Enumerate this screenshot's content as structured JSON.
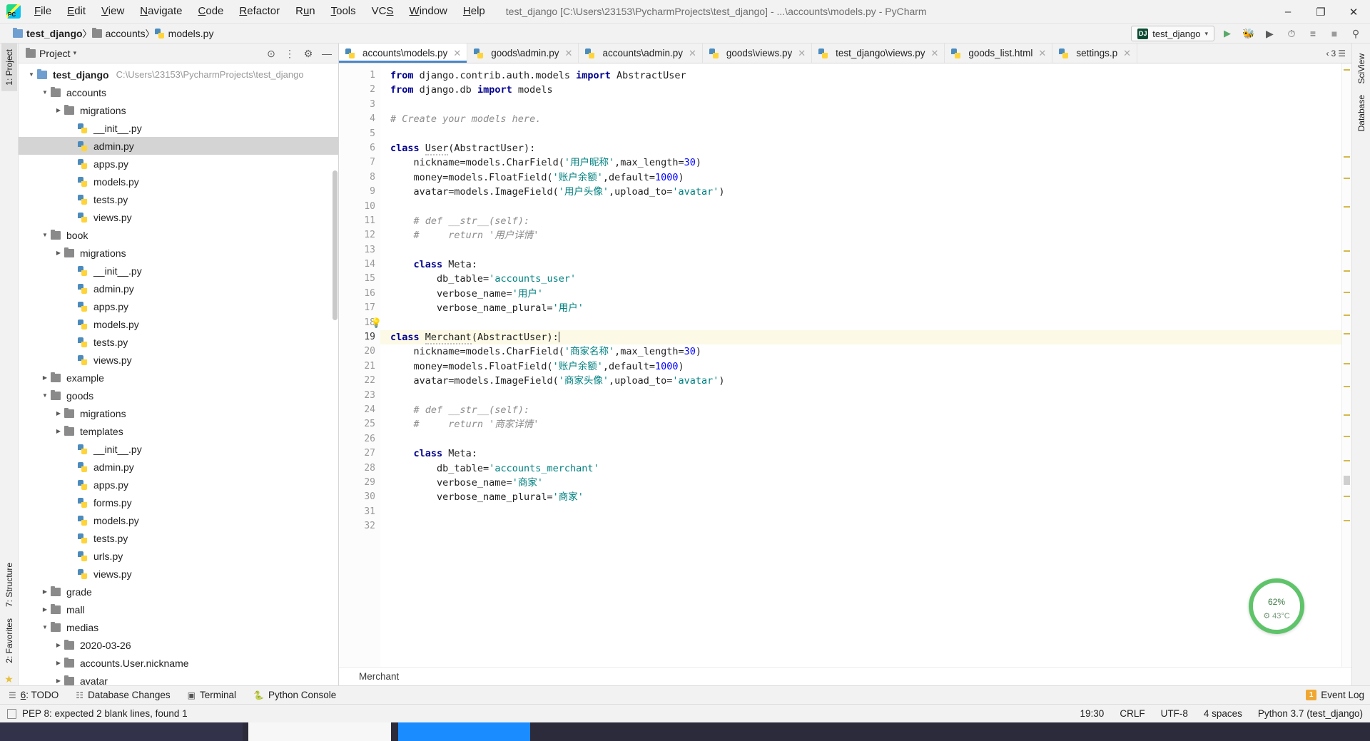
{
  "titlebar": {
    "logo_name": "pycharm-logo",
    "menus": [
      {
        "label": "File",
        "mn": "F"
      },
      {
        "label": "Edit",
        "mn": "E"
      },
      {
        "label": "View",
        "mn": "V"
      },
      {
        "label": "Navigate",
        "mn": "N"
      },
      {
        "label": "Code",
        "mn": "C"
      },
      {
        "label": "Refactor",
        "mn": "R"
      },
      {
        "label": "Run",
        "mn": "u"
      },
      {
        "label": "Tools",
        "mn": "T"
      },
      {
        "label": "VCS",
        "mn": "S"
      },
      {
        "label": "Window",
        "mn": "W"
      },
      {
        "label": "Help",
        "mn": "H"
      }
    ],
    "window_title": "test_django [C:\\Users\\23153\\PycharmProjects\\test_django] - ...\\accounts\\models.py - PyCharm",
    "minimize": "–",
    "maximize": "❐",
    "close": "✕"
  },
  "navbar": {
    "crumbs": [
      {
        "label": "test_django",
        "icon": "folder-icon"
      },
      {
        "label": "accounts",
        "icon": "folder-icon"
      },
      {
        "label": "models.py",
        "icon": "python-file-icon"
      }
    ],
    "run_config": "test_django",
    "run_config_badge": "DJ",
    "actions": [
      "run-icon",
      "debug-icon",
      "run-coverage-icon",
      "profile-icon",
      "attach-icon",
      "stop-icon",
      "search-everywhere-icon"
    ]
  },
  "left_strip": {
    "project_tab": "1: Project",
    "structure_tab": "7: Structure",
    "favorites_tab": "2: Favorites"
  },
  "right_strip": {
    "sciview_tab": "SciView",
    "database_tab": "Database"
  },
  "project_panel": {
    "title": "Project",
    "tree": [
      {
        "depth": 0,
        "twisty": "open",
        "icon": "folder-blue",
        "label": "test_django",
        "bold": true,
        "path": "C:\\Users\\23153\\PycharmProjects\\test_django"
      },
      {
        "depth": 1,
        "twisty": "open",
        "icon": "folder",
        "label": "accounts"
      },
      {
        "depth": 2,
        "twisty": "closed",
        "icon": "folder",
        "label": "migrations"
      },
      {
        "depth": 3,
        "twisty": "none",
        "icon": "py",
        "label": "__init__.py"
      },
      {
        "depth": 3,
        "twisty": "none",
        "icon": "py",
        "label": "admin.py",
        "selected": true
      },
      {
        "depth": 3,
        "twisty": "none",
        "icon": "py",
        "label": "apps.py"
      },
      {
        "depth": 3,
        "twisty": "none",
        "icon": "py",
        "label": "models.py"
      },
      {
        "depth": 3,
        "twisty": "none",
        "icon": "py",
        "label": "tests.py"
      },
      {
        "depth": 3,
        "twisty": "none",
        "icon": "py",
        "label": "views.py"
      },
      {
        "depth": 1,
        "twisty": "open",
        "icon": "folder",
        "label": "book"
      },
      {
        "depth": 2,
        "twisty": "closed",
        "icon": "folder",
        "label": "migrations"
      },
      {
        "depth": 3,
        "twisty": "none",
        "icon": "py",
        "label": "__init__.py"
      },
      {
        "depth": 3,
        "twisty": "none",
        "icon": "py",
        "label": "admin.py"
      },
      {
        "depth": 3,
        "twisty": "none",
        "icon": "py",
        "label": "apps.py"
      },
      {
        "depth": 3,
        "twisty": "none",
        "icon": "py",
        "label": "models.py"
      },
      {
        "depth": 3,
        "twisty": "none",
        "icon": "py",
        "label": "tests.py"
      },
      {
        "depth": 3,
        "twisty": "none",
        "icon": "py",
        "label": "views.py"
      },
      {
        "depth": 1,
        "twisty": "closed",
        "icon": "folder",
        "label": "example"
      },
      {
        "depth": 1,
        "twisty": "open",
        "icon": "folder",
        "label": "goods"
      },
      {
        "depth": 2,
        "twisty": "closed",
        "icon": "folder",
        "label": "migrations"
      },
      {
        "depth": 2,
        "twisty": "closed",
        "icon": "folder",
        "label": "templates"
      },
      {
        "depth": 3,
        "twisty": "none",
        "icon": "py",
        "label": "__init__.py"
      },
      {
        "depth": 3,
        "twisty": "none",
        "icon": "py",
        "label": "admin.py"
      },
      {
        "depth": 3,
        "twisty": "none",
        "icon": "py",
        "label": "apps.py"
      },
      {
        "depth": 3,
        "twisty": "none",
        "icon": "py",
        "label": "forms.py"
      },
      {
        "depth": 3,
        "twisty": "none",
        "icon": "py",
        "label": "models.py"
      },
      {
        "depth": 3,
        "twisty": "none",
        "icon": "py",
        "label": "tests.py"
      },
      {
        "depth": 3,
        "twisty": "none",
        "icon": "py",
        "label": "urls.py"
      },
      {
        "depth": 3,
        "twisty": "none",
        "icon": "py",
        "label": "views.py"
      },
      {
        "depth": 1,
        "twisty": "closed",
        "icon": "folder",
        "label": "grade"
      },
      {
        "depth": 1,
        "twisty": "closed",
        "icon": "folder",
        "label": "mall"
      },
      {
        "depth": 1,
        "twisty": "open",
        "icon": "folder",
        "label": "medias"
      },
      {
        "depth": 2,
        "twisty": "closed",
        "icon": "folder",
        "label": "2020-03-26"
      },
      {
        "depth": 2,
        "twisty": "closed",
        "icon": "folder",
        "label": "accounts.User.nickname"
      },
      {
        "depth": 2,
        "twisty": "closed",
        "icon": "folder",
        "label": "avatar"
      }
    ]
  },
  "editor": {
    "tabs": [
      {
        "label": "accounts\\models.py",
        "active": true
      },
      {
        "label": "goods\\admin.py",
        "active": false
      },
      {
        "label": "accounts\\admin.py",
        "active": false
      },
      {
        "label": "goods\\views.py",
        "active": false
      },
      {
        "label": "test_django\\views.py",
        "active": false
      },
      {
        "label": "goods_list.html",
        "active": false
      },
      {
        "label": "settings.p",
        "active": false
      }
    ],
    "tab_overflow": "3",
    "breadcrumb_bottom": "Merchant",
    "code_lines": [
      {
        "n": 1,
        "fold": "tri",
        "html": "<span class=\"kw\">from</span> <span class=\"plain\">django.contrib.auth.models</span> <span class=\"kw\">import</span> <span class=\"plain\">AbstractUser</span>"
      },
      {
        "n": 2,
        "fold": "end",
        "html": "<span class=\"kw\">from</span> <span class=\"plain\">django.db</span> <span class=\"kw\">import</span> <span class=\"plain\">models</span>"
      },
      {
        "n": 3,
        "fold": "",
        "html": ""
      },
      {
        "n": 4,
        "fold": "",
        "html": "<span class=\"cmt\"># Create your models here.</span>"
      },
      {
        "n": 5,
        "fold": "",
        "html": ""
      },
      {
        "n": 6,
        "fold": "tri",
        "html": "<span class=\"kw\">class</span> <span class=\"plain squig\">User</span><span class=\"plain\">(AbstractUser):</span>"
      },
      {
        "n": 7,
        "fold": "",
        "html": "    <span class=\"plain\">nickname=models.CharField(</span><span class=\"str\">'用户昵称'</span><span class=\"plain\">,max_length=</span><span class=\"num\">30</span><span class=\"plain\">)</span>"
      },
      {
        "n": 8,
        "fold": "",
        "html": "    <span class=\"plain\">money=models.FloatField(</span><span class=\"str\">'账户余额'</span><span class=\"plain\">,default=</span><span class=\"num\">1000</span><span class=\"plain\">)</span>"
      },
      {
        "n": 9,
        "fold": "",
        "html": "    <span class=\"plain\">avatar=models.ImageField(</span><span class=\"str\">'用户头像'</span><span class=\"plain\">,upload_to=</span><span class=\"str\">'avatar'</span><span class=\"plain\">)</span>"
      },
      {
        "n": 10,
        "fold": "",
        "html": ""
      },
      {
        "n": 11,
        "fold": "tri",
        "html": "    <span class=\"cmt\"># def __str__(self):</span>"
      },
      {
        "n": 12,
        "fold": "end",
        "html": "    <span class=\"cmt\">#     return '用户详情'</span>"
      },
      {
        "n": 13,
        "fold": "",
        "html": ""
      },
      {
        "n": 14,
        "fold": "tri",
        "html": "    <span class=\"kw\">class</span> <span class=\"plain\">Meta:</span>"
      },
      {
        "n": 15,
        "fold": "",
        "html": "        <span class=\"plain\">db_table=</span><span class=\"str\">'accounts_user'</span>"
      },
      {
        "n": 16,
        "fold": "",
        "html": "        <span class=\"plain\">verbose_name=</span><span class=\"str\">'用户'</span>"
      },
      {
        "n": 17,
        "fold": "end",
        "html": "        <span class=\"plain\">verbose_name_plural=</span><span class=\"str\">'用户'</span>"
      },
      {
        "n": 18,
        "fold": "",
        "bulb": true,
        "html": ""
      },
      {
        "n": 19,
        "fold": "tri",
        "cur": true,
        "html": "<span class=\"kw\">class</span> <span class=\"plain squig\">Merchant</span><span class=\"plain\">(AbstractUser):</span><span class=\"caret-bar\"></span>"
      },
      {
        "n": 20,
        "fold": "",
        "html": "    <span class=\"plain\">nickname=models.CharField(</span><span class=\"str\">'商家名称'</span><span class=\"plain\">,max_length=</span><span class=\"num\">30</span><span class=\"plain\">)</span>"
      },
      {
        "n": 21,
        "fold": "",
        "html": "    <span class=\"plain\">money=models.FloatField(</span><span class=\"str\">'账户余额'</span><span class=\"plain\">,default=</span><span class=\"num\">1000</span><span class=\"plain\">)</span>"
      },
      {
        "n": 22,
        "fold": "",
        "html": "    <span class=\"plain\">avatar=models.ImageField(</span><span class=\"str\">'商家头像'</span><span class=\"plain\">,upload_to=</span><span class=\"str\">'avatar'</span><span class=\"plain\">)</span>"
      },
      {
        "n": 23,
        "fold": "",
        "html": ""
      },
      {
        "n": 24,
        "fold": "tri",
        "html": "    <span class=\"cmt\"># def __str__(self):</span>"
      },
      {
        "n": 25,
        "fold": "end",
        "html": "    <span class=\"cmt\">#     return '商家详情'</span>"
      },
      {
        "n": 26,
        "fold": "",
        "html": ""
      },
      {
        "n": 27,
        "fold": "tri",
        "html": "    <span class=\"kw\">class</span> <span class=\"plain\">Meta:</span>"
      },
      {
        "n": 28,
        "fold": "",
        "html": "        <span class=\"plain\">db_table=</span><span class=\"str\">'accounts_merchant'</span>"
      },
      {
        "n": 29,
        "fold": "",
        "html": "        <span class=\"plain\">verbose_name=</span><span class=\"str\">'商家'</span>"
      },
      {
        "n": 30,
        "fold": "end",
        "html": "        <span class=\"plain\">verbose_name_plural=</span><span class=\"str\">'商家'</span>"
      },
      {
        "n": 31,
        "fold": "",
        "html": ""
      },
      {
        "n": 32,
        "fold": "",
        "html": "        <span class=\"plain\"> </span>"
      }
    ]
  },
  "cpu_widget": {
    "percent": "62",
    "percent_symbol": "%",
    "temperature": "43°C"
  },
  "bottom_toolbar": {
    "items": [
      {
        "label": "6: TODO",
        "mn": "6",
        "icon": "todo-icon"
      },
      {
        "label": "Database Changes",
        "icon": "database-changes-icon"
      },
      {
        "label": "Terminal",
        "icon": "terminal-icon"
      },
      {
        "label": "Python Console",
        "icon": "python-console-icon"
      }
    ],
    "event_log": "Event Log",
    "event_log_count": "1"
  },
  "statusbar": {
    "message": "PEP 8: expected 2 blank lines, found 1",
    "caret_position": "19:30",
    "line_separator": "CRLF",
    "encoding": "UTF-8",
    "indent": "4 spaces",
    "interpreter": "Python 3.7 (test_django)"
  },
  "colors": {
    "accent": "#4a86c8",
    "keyword": "#00008f",
    "string": "#008080",
    "comment": "#8c8c8c",
    "selection": "#d4d4d4",
    "cpu_ring": "#5fc36a"
  }
}
